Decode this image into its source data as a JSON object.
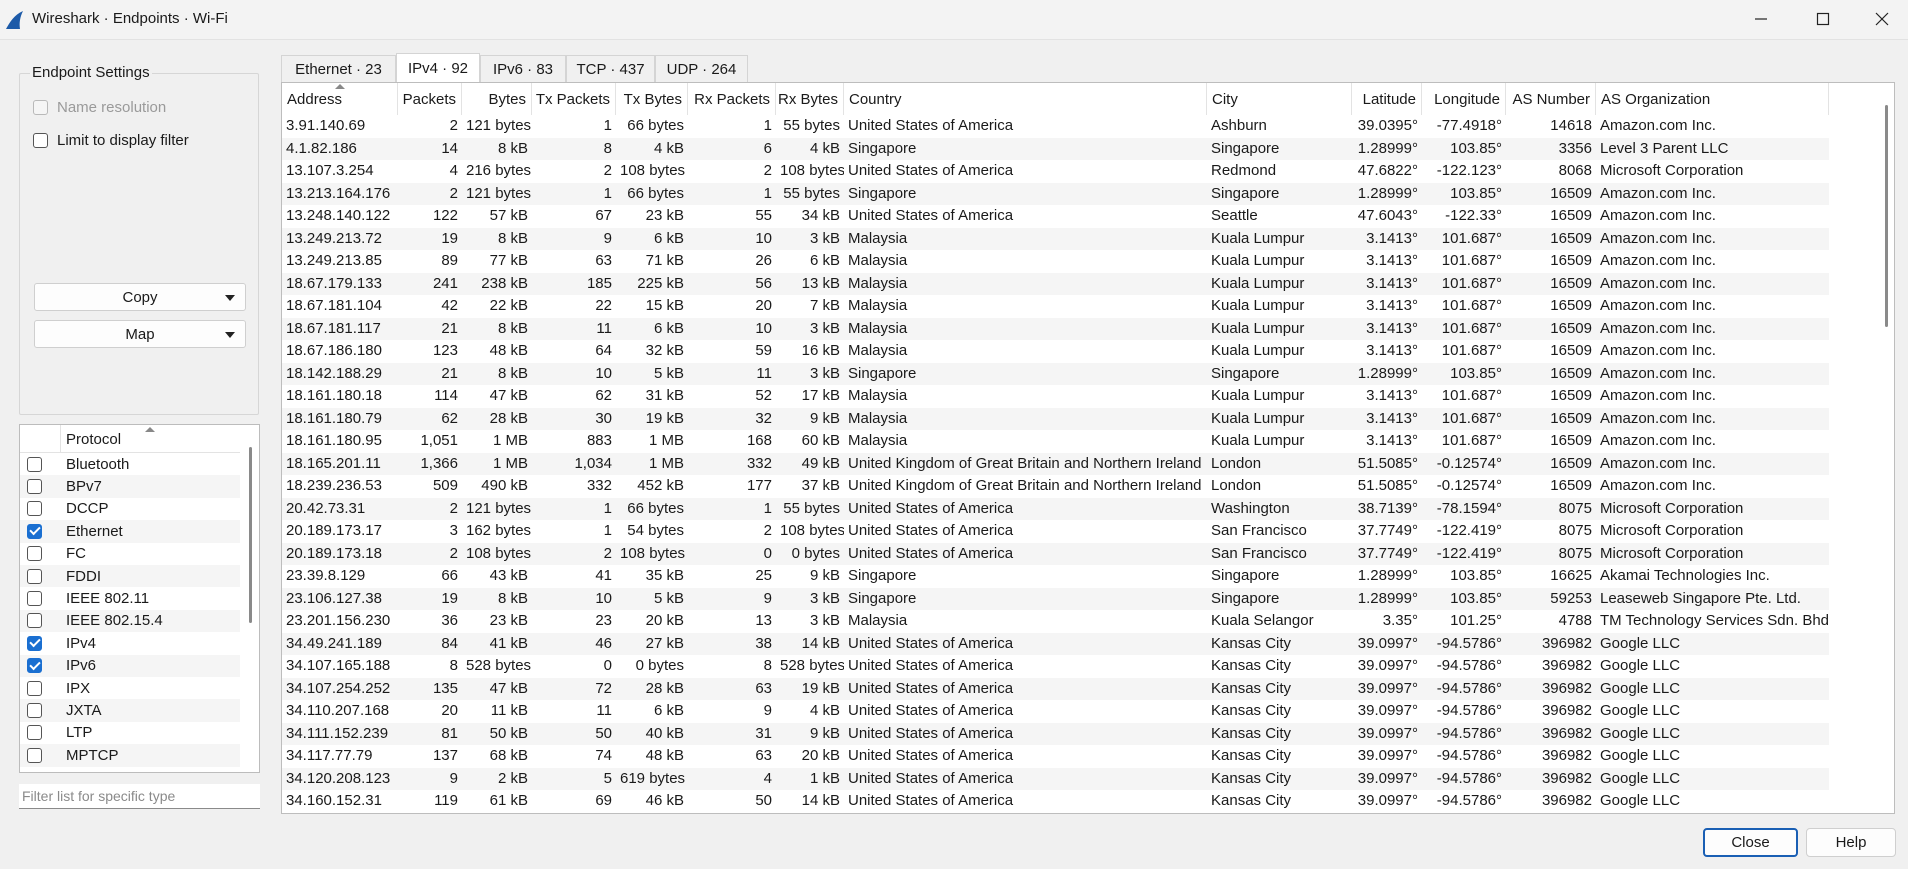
{
  "window": {
    "title": "Wireshark · Endpoints · Wi-Fi"
  },
  "settings": {
    "title": "Endpoint Settings",
    "name_resolution": "Name resolution",
    "limit_filter": "Limit to display filter",
    "copy_label": "Copy",
    "map_label": "Map"
  },
  "protocols": {
    "header": "Protocol",
    "items": [
      {
        "label": "Bluetooth",
        "checked": false
      },
      {
        "label": "BPv7",
        "checked": false
      },
      {
        "label": "DCCP",
        "checked": false
      },
      {
        "label": "Ethernet",
        "checked": true
      },
      {
        "label": "FC",
        "checked": false
      },
      {
        "label": "FDDI",
        "checked": false
      },
      {
        "label": "IEEE 802.11",
        "checked": false
      },
      {
        "label": "IEEE 802.15.4",
        "checked": false
      },
      {
        "label": "IPv4",
        "checked": true
      },
      {
        "label": "IPv6",
        "checked": true
      },
      {
        "label": "IPX",
        "checked": false
      },
      {
        "label": "JXTA",
        "checked": false
      },
      {
        "label": "LTP",
        "checked": false
      },
      {
        "label": "MPTCP",
        "checked": false
      }
    ],
    "filter_placeholder": "Filter list for specific type"
  },
  "tabs": [
    {
      "label": "Ethernet · 23"
    },
    {
      "label": "IPv4 · 92"
    },
    {
      "label": "IPv6 · 83"
    },
    {
      "label": "TCP · 437"
    },
    {
      "label": "UDP · 264"
    }
  ],
  "table": {
    "columns": [
      "Address",
      "Packets",
      "Bytes",
      "Tx Packets",
      "Tx Bytes",
      "Rx Packets",
      "Rx Bytes",
      "Country",
      "City",
      "Latitude",
      "Longitude",
      "AS Number",
      "AS Organization"
    ],
    "rows": [
      [
        "3.91.140.69",
        "2",
        "121 bytes",
        "1",
        "66 bytes",
        "1",
        "55 bytes",
        "United States of America",
        "Ashburn",
        "39.0395°",
        "-77.4918°",
        "14618",
        "Amazon.com Inc."
      ],
      [
        "4.1.82.186",
        "14",
        "8 kB",
        "8",
        "4 kB",
        "6",
        "4 kB",
        "Singapore",
        "Singapore",
        "1.28999°",
        "103.85°",
        "3356",
        "Level 3 Parent LLC"
      ],
      [
        "13.107.3.254",
        "4",
        "216 bytes",
        "2",
        "108 bytes",
        "2",
        "108 bytes",
        "United States of America",
        "Redmond",
        "47.6822°",
        "-122.123°",
        "8068",
        "Microsoft Corporation"
      ],
      [
        "13.213.164.176",
        "2",
        "121 bytes",
        "1",
        "66 bytes",
        "1",
        "55 bytes",
        "Singapore",
        "Singapore",
        "1.28999°",
        "103.85°",
        "16509",
        "Amazon.com Inc."
      ],
      [
        "13.248.140.122",
        "122",
        "57 kB",
        "67",
        "23 kB",
        "55",
        "34 kB",
        "United States of America",
        "Seattle",
        "47.6043°",
        "-122.33°",
        "16509",
        "Amazon.com Inc."
      ],
      [
        "13.249.213.72",
        "19",
        "8 kB",
        "9",
        "6 kB",
        "10",
        "3 kB",
        "Malaysia",
        "Kuala Lumpur",
        "3.1413°",
        "101.687°",
        "16509",
        "Amazon.com Inc."
      ],
      [
        "13.249.213.85",
        "89",
        "77 kB",
        "63",
        "71 kB",
        "26",
        "6 kB",
        "Malaysia",
        "Kuala Lumpur",
        "3.1413°",
        "101.687°",
        "16509",
        "Amazon.com Inc."
      ],
      [
        "18.67.179.133",
        "241",
        "238 kB",
        "185",
        "225 kB",
        "56",
        "13 kB",
        "Malaysia",
        "Kuala Lumpur",
        "3.1413°",
        "101.687°",
        "16509",
        "Amazon.com Inc."
      ],
      [
        "18.67.181.104",
        "42",
        "22 kB",
        "22",
        "15 kB",
        "20",
        "7 kB",
        "Malaysia",
        "Kuala Lumpur",
        "3.1413°",
        "101.687°",
        "16509",
        "Amazon.com Inc."
      ],
      [
        "18.67.181.117",
        "21",
        "8 kB",
        "11",
        "6 kB",
        "10",
        "3 kB",
        "Malaysia",
        "Kuala Lumpur",
        "3.1413°",
        "101.687°",
        "16509",
        "Amazon.com Inc."
      ],
      [
        "18.67.186.180",
        "123",
        "48 kB",
        "64",
        "32 kB",
        "59",
        "16 kB",
        "Malaysia",
        "Kuala Lumpur",
        "3.1413°",
        "101.687°",
        "16509",
        "Amazon.com Inc."
      ],
      [
        "18.142.188.29",
        "21",
        "8 kB",
        "10",
        "5 kB",
        "11",
        "3 kB",
        "Singapore",
        "Singapore",
        "1.28999°",
        "103.85°",
        "16509",
        "Amazon.com Inc."
      ],
      [
        "18.161.180.18",
        "114",
        "47 kB",
        "62",
        "31 kB",
        "52",
        "17 kB",
        "Malaysia",
        "Kuala Lumpur",
        "3.1413°",
        "101.687°",
        "16509",
        "Amazon.com Inc."
      ],
      [
        "18.161.180.79",
        "62",
        "28 kB",
        "30",
        "19 kB",
        "32",
        "9 kB",
        "Malaysia",
        "Kuala Lumpur",
        "3.1413°",
        "101.687°",
        "16509",
        "Amazon.com Inc."
      ],
      [
        "18.161.180.95",
        "1,051",
        "1 MB",
        "883",
        "1 MB",
        "168",
        "60 kB",
        "Malaysia",
        "Kuala Lumpur",
        "3.1413°",
        "101.687°",
        "16509",
        "Amazon.com Inc."
      ],
      [
        "18.165.201.11",
        "1,366",
        "1 MB",
        "1,034",
        "1 MB",
        "332",
        "49 kB",
        "United Kingdom of Great Britain and Northern Ireland",
        "London",
        "51.5085°",
        "-0.12574°",
        "16509",
        "Amazon.com Inc."
      ],
      [
        "18.239.236.53",
        "509",
        "490 kB",
        "332",
        "452 kB",
        "177",
        "37 kB",
        "United Kingdom of Great Britain and Northern Ireland",
        "London",
        "51.5085°",
        "-0.12574°",
        "16509",
        "Amazon.com Inc."
      ],
      [
        "20.42.73.31",
        "2",
        "121 bytes",
        "1",
        "66 bytes",
        "1",
        "55 bytes",
        "United States of America",
        "Washington",
        "38.7139°",
        "-78.1594°",
        "8075",
        "Microsoft Corporation"
      ],
      [
        "20.189.173.17",
        "3",
        "162 bytes",
        "1",
        "54 bytes",
        "2",
        "108 bytes",
        "United States of America",
        "San Francisco",
        "37.7749°",
        "-122.419°",
        "8075",
        "Microsoft Corporation"
      ],
      [
        "20.189.173.18",
        "2",
        "108 bytes",
        "2",
        "108 bytes",
        "0",
        "0 bytes",
        "United States of America",
        "San Francisco",
        "37.7749°",
        "-122.419°",
        "8075",
        "Microsoft Corporation"
      ],
      [
        "23.39.8.129",
        "66",
        "43 kB",
        "41",
        "35 kB",
        "25",
        "9 kB",
        "Singapore",
        "Singapore",
        "1.28999°",
        "103.85°",
        "16625",
        "Akamai Technologies Inc."
      ],
      [
        "23.106.127.38",
        "19",
        "8 kB",
        "10",
        "5 kB",
        "9",
        "3 kB",
        "Singapore",
        "Singapore",
        "1.28999°",
        "103.85°",
        "59253",
        "Leaseweb Singapore Pte. Ltd."
      ],
      [
        "23.201.156.230",
        "36",
        "23 kB",
        "23",
        "20 kB",
        "13",
        "3 kB",
        "Malaysia",
        "Kuala Selangor",
        "3.35°",
        "101.25°",
        "4788",
        "TM Technology Services Sdn. Bhd."
      ],
      [
        "34.49.241.189",
        "84",
        "41 kB",
        "46",
        "27 kB",
        "38",
        "14 kB",
        "United States of America",
        "Kansas City",
        "39.0997°",
        "-94.5786°",
        "396982",
        "Google LLC"
      ],
      [
        "34.107.165.188",
        "8",
        "528 bytes",
        "0",
        "0 bytes",
        "8",
        "528 bytes",
        "United States of America",
        "Kansas City",
        "39.0997°",
        "-94.5786°",
        "396982",
        "Google LLC"
      ],
      [
        "34.107.254.252",
        "135",
        "47 kB",
        "72",
        "28 kB",
        "63",
        "19 kB",
        "United States of America",
        "Kansas City",
        "39.0997°",
        "-94.5786°",
        "396982",
        "Google LLC"
      ],
      [
        "34.110.207.168",
        "20",
        "11 kB",
        "11",
        "6 kB",
        "9",
        "4 kB",
        "United States of America",
        "Kansas City",
        "39.0997°",
        "-94.5786°",
        "396982",
        "Google LLC"
      ],
      [
        "34.111.152.239",
        "81",
        "50 kB",
        "50",
        "40 kB",
        "31",
        "9 kB",
        "United States of America",
        "Kansas City",
        "39.0997°",
        "-94.5786°",
        "396982",
        "Google LLC"
      ],
      [
        "34.117.77.79",
        "137",
        "68 kB",
        "74",
        "48 kB",
        "63",
        "20 kB",
        "United States of America",
        "Kansas City",
        "39.0997°",
        "-94.5786°",
        "396982",
        "Google LLC"
      ],
      [
        "34.120.208.123",
        "9",
        "2 kB",
        "5",
        "619 bytes",
        "4",
        "1 kB",
        "United States of America",
        "Kansas City",
        "39.0997°",
        "-94.5786°",
        "396982",
        "Google LLC"
      ],
      [
        "34.160.152.31",
        "119",
        "61 kB",
        "69",
        "46 kB",
        "50",
        "14 kB",
        "United States of America",
        "Kansas City",
        "39.0997°",
        "-94.5786°",
        "396982",
        "Google LLC"
      ]
    ]
  },
  "buttons": {
    "close": "Close",
    "help": "Help"
  },
  "colors": {
    "accent": "#1a6fd1",
    "wireshark_fin": "#1c5aa8"
  },
  "icons": [
    "wireshark-fin-icon",
    "minimize-icon",
    "maximize-icon",
    "close-window-icon",
    "chevron-down-icon",
    "sort-caret-icon"
  ]
}
